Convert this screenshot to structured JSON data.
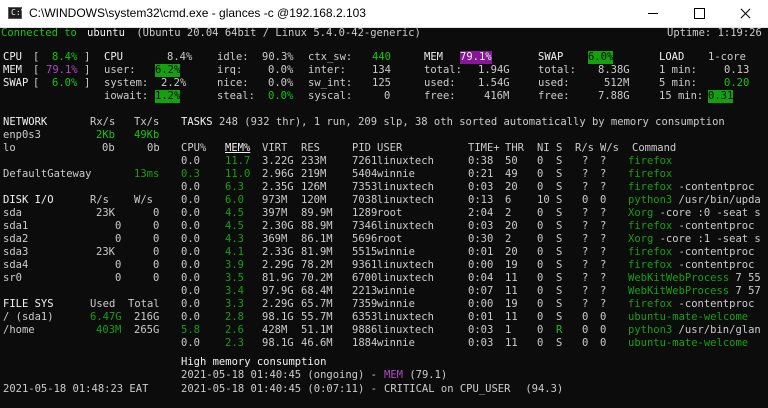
{
  "window": {
    "title": "C:\\WINDOWS\\system32\\cmd.exe - glances  -c @192.168.2.103",
    "icon": "C:\\",
    "controls": [
      "minimize-icon",
      "maximize-icon",
      "close-icon"
    ]
  },
  "colors": {
    "green": "#16c60c",
    "dark_green": "#13a10e",
    "magenta": "#b148c6",
    "magenta_bg": "#881798",
    "text": "#cccccc",
    "bright": "#f2f2f2",
    "background": "#0c0c0c"
  },
  "header": {
    "connected": "Connected to ",
    "host": "ubuntu",
    "os": " (Ubuntu 20.04 64bit / Linux 5.4.0-42-generic)",
    "uptime": "Uptime: 1:19:26"
  },
  "quicklook": [
    {
      "label": "CPU ",
      "open": "[",
      "value": "8.4%",
      "close": "]"
    },
    {
      "label": "MEM ",
      "open": "[",
      "value": "79.1%",
      "close": "]"
    },
    {
      "label": "SWAP",
      "open": "[",
      "value": "6.0%",
      "close": "]"
    }
  ],
  "cpu": {
    "title": "CPU",
    "total": "8.4%",
    "rows": [
      [
        "user:",
        "6.2%",
        "irq:",
        "0.0%",
        "inter:",
        "134"
      ],
      [
        "system:",
        "2.2%",
        "nice:",
        "0.0%",
        "sw_int:",
        "125"
      ],
      [
        "iowait:",
        "1.2%",
        "steal:",
        "0.0%",
        "syscal:",
        "0"
      ]
    ],
    "idle_label": "idle:",
    "idle": "90.3%",
    "ctx_label": "ctx_sw:",
    "ctx": "440"
  },
  "mem": {
    "title": "MEM",
    "pct": "79.1%",
    "rows": [
      [
        "total:",
        "1.94G"
      ],
      [
        "used:",
        "1.54G"
      ],
      [
        "free:",
        "416M"
      ]
    ]
  },
  "swap": {
    "title": "SWAP",
    "pct": "6.0%",
    "rows": [
      [
        "total:",
        "8.38G"
      ],
      [
        "used:",
        "512M"
      ],
      [
        "free:",
        "7.88G"
      ]
    ]
  },
  "load": {
    "title": "LOAD",
    "cores": "1-core",
    "rows": [
      [
        "1 min:",
        "0.13"
      ],
      [
        "5 min:",
        "0.20"
      ],
      [
        "15 min:",
        "0.31"
      ]
    ]
  },
  "network": {
    "headers": [
      "NETWORK",
      "Rx/s",
      "Tx/s"
    ],
    "rows": [
      [
        "enp0s3",
        "2Kb",
        "49Kb"
      ],
      [
        "lo",
        "0b",
        "0b"
      ]
    ],
    "gateway": [
      "DefaultGateway",
      "13ms"
    ]
  },
  "disk": {
    "headers": [
      "DISK I/O",
      "R/s",
      "W/s"
    ],
    "rows": [
      [
        "sda",
        "23K",
        "0"
      ],
      [
        "sda1",
        "0",
        "0"
      ],
      [
        "sda2",
        "0",
        "0"
      ],
      [
        "sda3",
        "23K",
        "0"
      ],
      [
        "sda4",
        "0",
        "0"
      ],
      [
        "sr0",
        "0",
        "0"
      ]
    ]
  },
  "filesys": {
    "headers": [
      "FILE SYS",
      "Used",
      "Total"
    ],
    "rows": [
      [
        "/ (sda1)",
        "6.47G",
        "216G"
      ],
      [
        "/home",
        "403M",
        "265G"
      ]
    ]
  },
  "tasks": {
    "label": "TASKS",
    "summary": "248 (932 thr), 1 run, 209 slp, 38 oth sorted automatically by memory consumption"
  },
  "process_headers": [
    "CPU%",
    "MEM%",
    "VIRT",
    "RES",
    "PID",
    "USER",
    "TIME+",
    "THR",
    "NI",
    "S",
    "R/s",
    "W/s",
    "Command"
  ],
  "processes": [
    [
      "0.0",
      "11.7",
      "3.22G",
      "233M",
      "7261",
      "linuxtech",
      "0:38",
      "50",
      "0",
      "S",
      "?",
      "?",
      "firefox",
      ""
    ],
    [
      "0.3",
      "11.0",
      "2.96G",
      "219M",
      "5404",
      "winnie",
      "0:21",
      "49",
      "0",
      "S",
      "?",
      "?",
      "firefox",
      ""
    ],
    [
      "0.0",
      "6.3",
      "2.35G",
      "126M",
      "7353",
      "linuxtech",
      "0:03",
      "20",
      "0",
      "S",
      "?",
      "?",
      "firefox",
      " -contentproc"
    ],
    [
      "0.0",
      "6.0",
      "973M",
      "120M",
      "7038",
      "linuxtech",
      "0:13",
      "6",
      "10",
      "S",
      "0",
      "0",
      "python3",
      " /usr/bin/upda"
    ],
    [
      "0.0",
      "4.5",
      "397M",
      "89.9M",
      "1289",
      "root",
      "2:04",
      "2",
      "0",
      "S",
      "?",
      "?",
      "Xorg",
      " -core :0 -seat s"
    ],
    [
      "0.0",
      "4.5",
      "2.30G",
      "88.9M",
      "7346",
      "linuxtech",
      "0:03",
      "20",
      "0",
      "S",
      "?",
      "?",
      "firefox",
      " -contentproc"
    ],
    [
      "0.0",
      "4.3",
      "369M",
      "86.1M",
      "5696",
      "root",
      "0:30",
      "2",
      "0",
      "S",
      "?",
      "?",
      "Xorg",
      " -core :1 -seat s"
    ],
    [
      "0.0",
      "4.1",
      "2.33G",
      "81.9M",
      "5515",
      "winnie",
      "0:01",
      "20",
      "0",
      "S",
      "?",
      "?",
      "firefox",
      " -contentproc"
    ],
    [
      "0.0",
      "3.9",
      "2.29G",
      "78.2M",
      "9361",
      "linuxtech",
      "0:00",
      "19",
      "0",
      "S",
      "?",
      "?",
      "firefox",
      " -contentproc"
    ],
    [
      "0.0",
      "3.5",
      "81.9G",
      "70.2M",
      "6700",
      "linuxtech",
      "0:04",
      "11",
      "0",
      "S",
      "?",
      "?",
      "WebKitWebProcess",
      " 7 55"
    ],
    [
      "0.0",
      "3.4",
      "97.9G",
      "68.4M",
      "2213",
      "winnie",
      "0:07",
      "11",
      "0",
      "S",
      "?",
      "?",
      "WebKitWebProcess",
      " 7 57"
    ],
    [
      "0.0",
      "3.3",
      "2.29G",
      "65.7M",
      "7359",
      "winnie",
      "0:00",
      "19",
      "0",
      "S",
      "?",
      "?",
      "firefox",
      " -contentproc"
    ],
    [
      "0.0",
      "2.8",
      "98.1G",
      "55.7M",
      "6353",
      "linuxtech",
      "0:01",
      "11",
      "0",
      "S",
      "0",
      "0",
      "ubuntu-mate-welcome",
      ""
    ],
    [
      "5.8",
      "2.6",
      "428M",
      "51.1M",
      "9886",
      "linuxtech",
      "0:03",
      "1",
      "0",
      "R",
      "0",
      "0",
      "python3",
      " /usr/bin/glan"
    ],
    [
      "0.0",
      "2.3",
      "98.1G",
      "46.6M",
      "1884",
      "winnie",
      "0:03",
      "11",
      "0",
      "S",
      "0",
      "0",
      "ubuntu-mate-welcome",
      ""
    ]
  ],
  "alerts": {
    "title": "High memory consumption",
    "lines": [
      {
        "time": "2021-05-18 01:40:45 (ongoing) - ",
        "tag": "MEM",
        "value": " (79.1)"
      },
      {
        "time": "2021-05-18 01:40:45 (0:07:11) - ",
        "tag": "CRITICAL on CPU_USER",
        "value": " (94.3)"
      }
    ]
  },
  "clock": "2021-05-18 01:48:23 EAT"
}
